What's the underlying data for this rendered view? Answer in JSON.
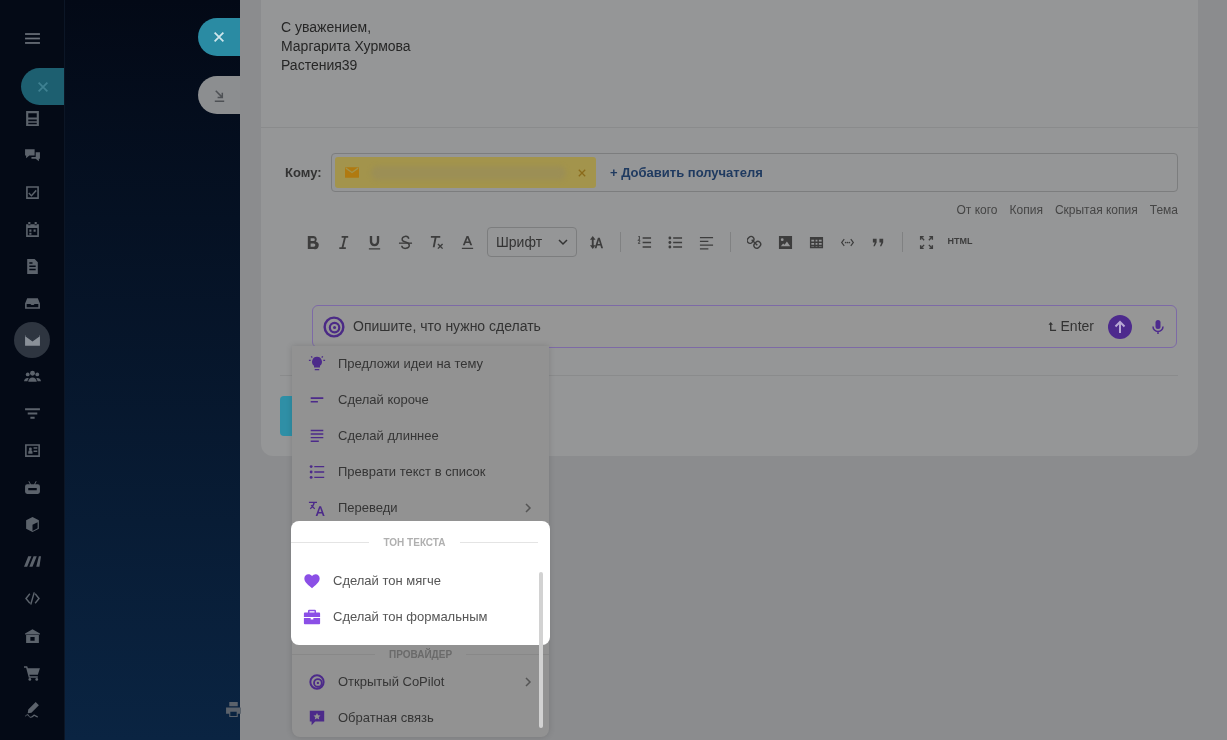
{
  "sidebar": {
    "items": [
      {
        "selected": false
      },
      {
        "selected": false
      },
      {
        "selected": false
      },
      {
        "selected": false
      },
      {
        "selected": false
      },
      {
        "selected": false
      },
      {
        "selected": true
      },
      {
        "selected": false
      },
      {
        "selected": false
      },
      {
        "selected": false
      },
      {
        "selected": false
      },
      {
        "selected": false
      },
      {
        "selected": false
      },
      {
        "selected": false
      },
      {
        "selected": false
      },
      {
        "selected": false
      },
      {
        "selected": false
      }
    ]
  },
  "signature": [
    "С уважением,",
    "Маргарита Хурмова",
    "Растения39"
  ],
  "recipients": {
    "label": "Кому:",
    "add_link": "+ Добавить получателя"
  },
  "field_links": [
    "От кого",
    "Копия",
    "Скрытая копия",
    "Тема"
  ],
  "toolbar": {
    "font_select": "Шрифт",
    "html_button": "HTML"
  },
  "prompt": {
    "placeholder": "Опишите, что нужно сделать",
    "hint": "Enter"
  },
  "menu": {
    "groups": [
      {
        "highlighted": false,
        "items": [
          {
            "label": "Предложи идеи на тему",
            "submenu": false
          },
          {
            "label": "Сделай короче",
            "submenu": false
          },
          {
            "label": "Сделай длиннее",
            "submenu": false
          },
          {
            "label": "Преврати текст в список",
            "submenu": false
          },
          {
            "label": "Переведи",
            "submenu": true
          }
        ]
      },
      {
        "title": "ТОН ТЕКСТА",
        "highlighted": true,
        "items": [
          {
            "label": "Сделай тон мягче",
            "submenu": false
          },
          {
            "label": "Сделай тон формальным",
            "submenu": false
          }
        ]
      },
      {
        "title": "ПРОВАЙДЕР",
        "highlighted": false,
        "items": [
          {
            "label": "Открытый CoPilot",
            "submenu": true
          },
          {
            "label": "Обратная связь",
            "submenu": false
          }
        ]
      }
    ]
  }
}
